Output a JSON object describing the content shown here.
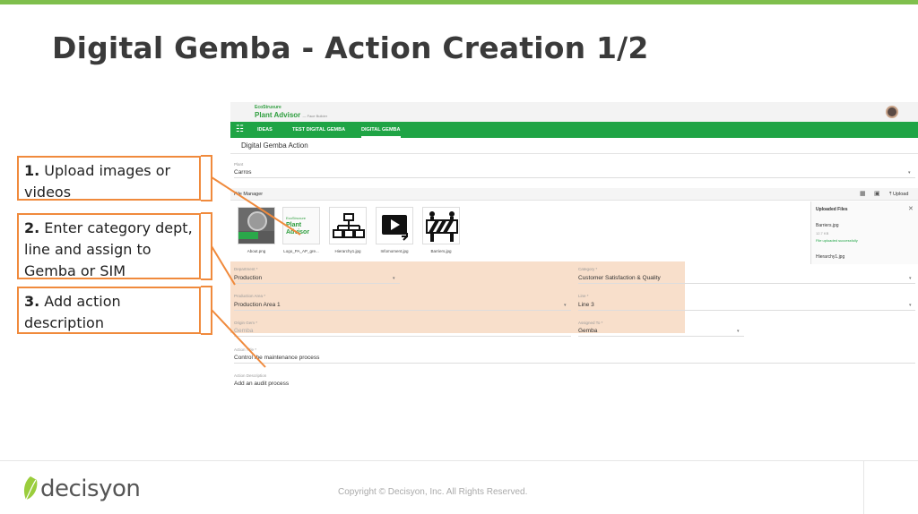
{
  "slide": {
    "title": "Digital Gemba - Action Creation 1/2"
  },
  "app": {
    "brand_small": "EcoStruxure",
    "brand_name": "Plant Advisor",
    "brand_sub": "— Face Builder",
    "nav_tabs": [
      "IDEAS",
      "TEST DIGITAL GEMBA",
      "DIGITAL GEMBA"
    ],
    "page_title": "Digital Gemba Action",
    "plant": {
      "label": "Plant",
      "value": "Carros"
    },
    "file_manager": {
      "title": "File Manager",
      "upload_label": "Upload",
      "files": [
        "About.png",
        "Logo_PA_AP_gre...",
        "Hierarchy1.jpg",
        "Infomoment.jpg",
        "Barriers.jpg"
      ]
    },
    "uploaded": {
      "title": "Uploaded Files",
      "file1": "Barriers.jpg",
      "size1": "12.7 KB",
      "status1": "File uploaded successfully",
      "file2": "Hierarchy1.jpg"
    },
    "fields": {
      "department": {
        "label": "Department *",
        "value": "Production"
      },
      "category": {
        "label": "Category *",
        "value": "Customer Satisfaction & Quality"
      },
      "production_area": {
        "label": "Production Area *",
        "value": "Production Area 1"
      },
      "line": {
        "label": "Line *",
        "value": "Line 3"
      },
      "origin_gem": {
        "label": "Origin Gem *",
        "value": "Gemba"
      },
      "assigned_to": {
        "label": "Assigned To *",
        "value": "Gemba"
      },
      "action_title": {
        "label": "Action Title *",
        "value": "Control the maintenance process"
      },
      "action_description": {
        "label": "Action Description",
        "value": "Add an audit process"
      }
    }
  },
  "callouts": [
    {
      "num": "1.",
      "text": " Upload images or videos"
    },
    {
      "num": "2.",
      "text": " Enter category dept, line and assign to Gemba or SIM"
    },
    {
      "num": "3.",
      "text": " Add action description"
    }
  ],
  "footer": {
    "logo_text": "decisyon",
    "copyright": "Copyright © Decisyon, Inc. All Rights Reserved."
  },
  "colors": {
    "accent_green": "#1fa445",
    "callout_orange": "#f08a3c",
    "top_bar": "#7fbf4d"
  }
}
